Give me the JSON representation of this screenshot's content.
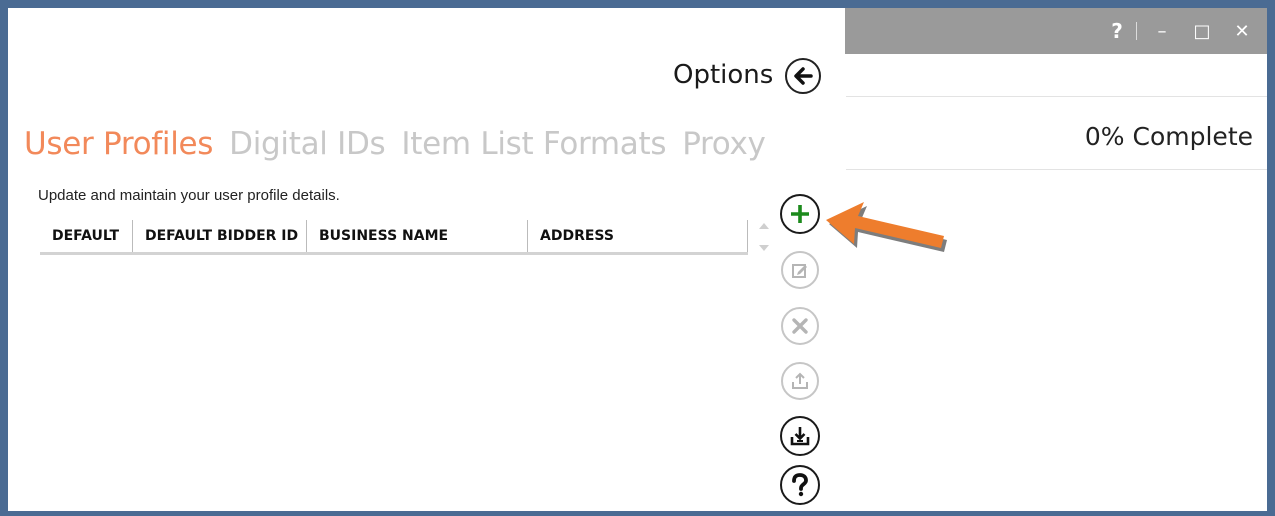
{
  "window": {
    "controls": {
      "help": "?",
      "minimize": "–",
      "maximize": "□",
      "close": "✕"
    }
  },
  "header": {
    "title": "Options",
    "back_icon": "arrow-left-icon"
  },
  "progress": {
    "text": "0% Complete",
    "value": 0
  },
  "tabs": [
    {
      "label": "User Profiles",
      "active": true
    },
    {
      "label": "Digital IDs",
      "active": false
    },
    {
      "label": "Item List Formats",
      "active": false
    },
    {
      "label": "Proxy",
      "active": false
    }
  ],
  "description": "Update and maintain your user profile details.",
  "table": {
    "columns": [
      "DEFAULT",
      "DEFAULT BIDDER ID",
      "BUSINESS NAME",
      "ADDRESS"
    ],
    "rows": []
  },
  "actions": [
    {
      "name": "add",
      "icon": "plus-icon",
      "enabled": true
    },
    {
      "name": "edit",
      "icon": "edit-icon",
      "enabled": false
    },
    {
      "name": "delete",
      "icon": "x-icon",
      "enabled": false
    },
    {
      "name": "export",
      "icon": "upload-icon",
      "enabled": false
    },
    {
      "name": "import",
      "icon": "download-icon",
      "enabled": true
    },
    {
      "name": "help",
      "icon": "question-icon",
      "enabled": true
    }
  ],
  "colors": {
    "active_tab": "#f2895a",
    "inactive_tab": "#c8c8c8",
    "add_icon": "#1c8a1c",
    "callout_arrow": "#ee7d2d",
    "window_border": "#4a6b93",
    "titlebar": "#9a9a9a"
  }
}
